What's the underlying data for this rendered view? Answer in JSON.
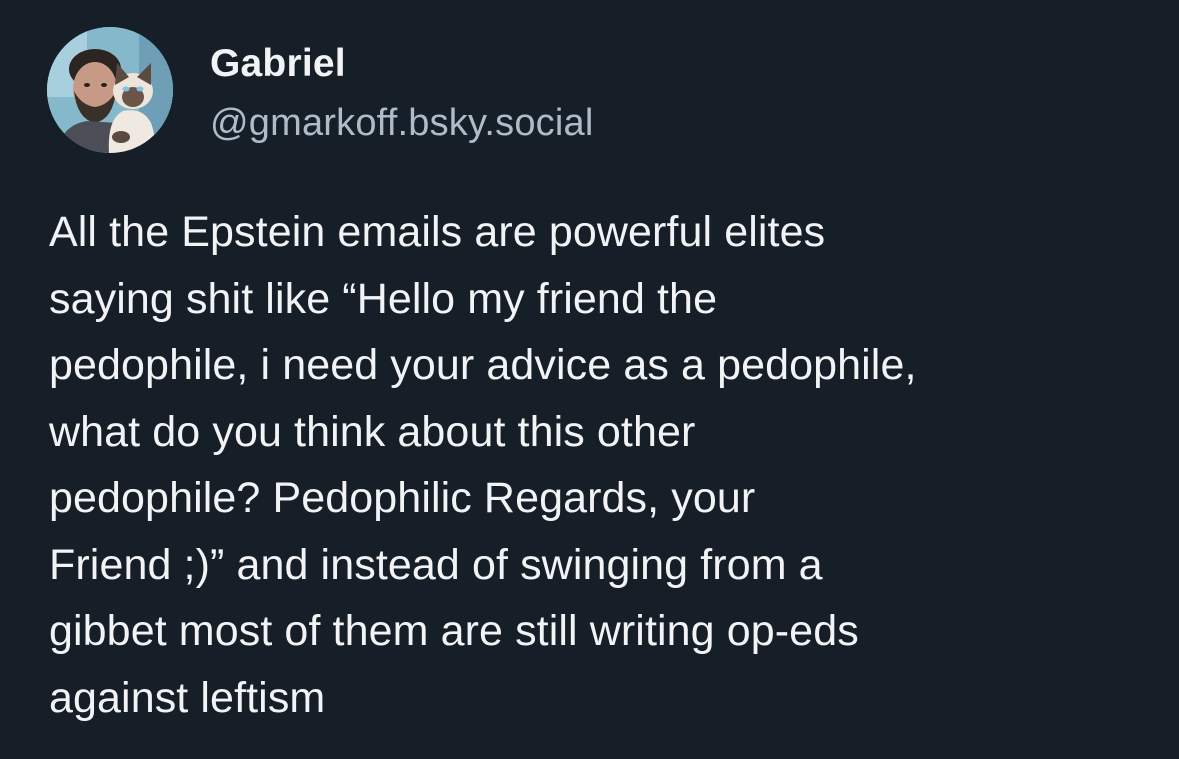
{
  "post": {
    "author": {
      "display_name": "Gabriel",
      "handle": "@gmarkoff.bsky.social",
      "avatar_description": "man holding siamese cat"
    },
    "text_lines": [
      "All the Epstein emails are powerful elites",
      "saying shit like “Hello my friend the",
      "pedophile, i need your advice as a pedophile,",
      "what do you think about this other",
      "pedophile? Pedophilic Regards, your",
      "Friend ;)” and instead of swinging from a",
      "gibbet most of them are still writing op-eds",
      "against leftism"
    ]
  },
  "colors": {
    "background": "#161e27",
    "text": "#f1f3f5",
    "handle": "#aebbc9"
  }
}
